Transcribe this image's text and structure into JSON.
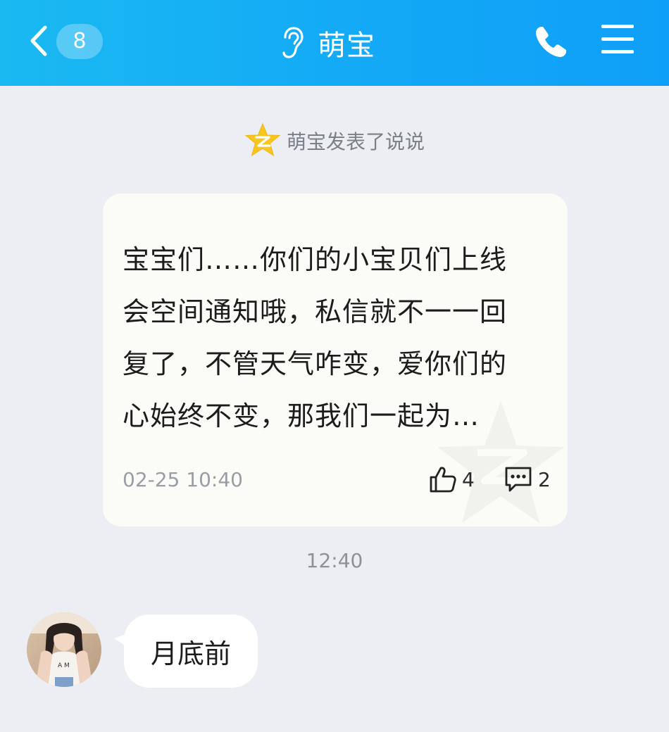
{
  "header": {
    "unread_count": "8",
    "title": "萌宝",
    "back_icon": "chevron-left-icon",
    "ear_icon": "ear-icon",
    "phone_icon": "phone-icon",
    "menu_icon": "menu-icon",
    "bg_color": "#13a9f6"
  },
  "notice": {
    "icon": "qzone-star-icon",
    "text": "萌宝发表了说说"
  },
  "post": {
    "lines": [
      "宝宝们……你们的小宝贝们上线",
      "会空间通知哦，私信就不一一回",
      "复了，不管天气咋变，爱你们的",
      "心始终不变，那我们一起为…"
    ],
    "time": "02-25 10:40",
    "likes": "4",
    "comments": "2"
  },
  "timestamp": "12:40",
  "message": {
    "text": "月底前"
  }
}
